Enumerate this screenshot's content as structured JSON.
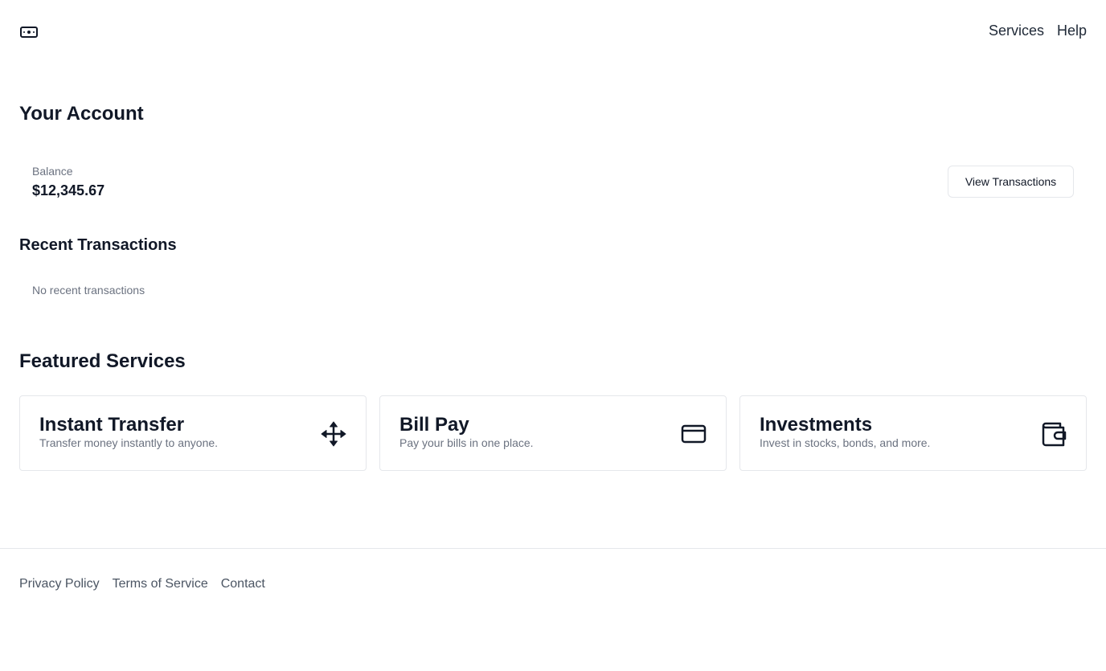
{
  "header": {
    "logo_icon": "banknote-icon",
    "nav": [
      {
        "label": "Services"
      },
      {
        "label": "Help"
      }
    ]
  },
  "account": {
    "title": "Your Account",
    "balance_label": "Balance",
    "balance_value": "$12,345.67",
    "view_transactions_label": "View Transactions"
  },
  "recent": {
    "title": "Recent Transactions",
    "empty_text": "No recent transactions"
  },
  "featured": {
    "title": "Featured Services",
    "cards": [
      {
        "title": "Instant Transfer",
        "description": "Transfer money instantly to anyone.",
        "icon": "move-arrows-icon"
      },
      {
        "title": "Bill Pay",
        "description": "Pay your bills in one place.",
        "icon": "credit-card-icon"
      },
      {
        "title": "Investments",
        "description": "Invest in stocks, bonds, and more.",
        "icon": "wallet-icon"
      }
    ]
  },
  "footer": {
    "links": [
      {
        "label": "Privacy Policy"
      },
      {
        "label": "Terms of Service"
      },
      {
        "label": "Contact"
      }
    ]
  },
  "colors": {
    "text_primary": "#111827",
    "text_muted": "#6b7280",
    "border": "#e5e7eb",
    "background": "#ffffff"
  }
}
